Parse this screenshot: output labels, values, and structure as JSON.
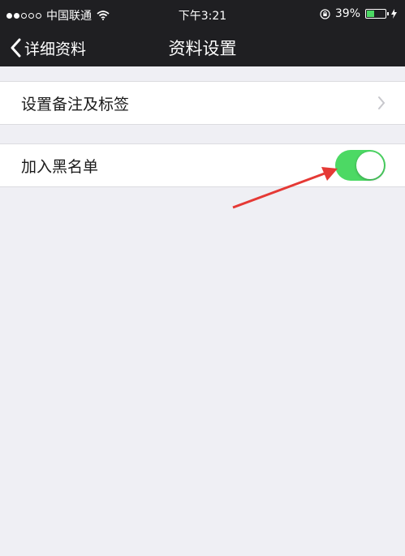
{
  "status_bar": {
    "carrier": "中国联通",
    "time": "下午3:21",
    "battery_percent": "39%",
    "battery_level": 0.39,
    "signal_bars_filled": 2,
    "signal_bars_total": 5
  },
  "nav": {
    "back_label": "详细资料",
    "title": "资料设置"
  },
  "rows": {
    "remark_label": "设置备注及标签",
    "blacklist_label": "加入黑名单",
    "blacklist_enabled": true
  },
  "colors": {
    "toggle_on": "#4cd964",
    "annotation_arrow": "#e53935",
    "bar_background": "#1f1f22"
  }
}
